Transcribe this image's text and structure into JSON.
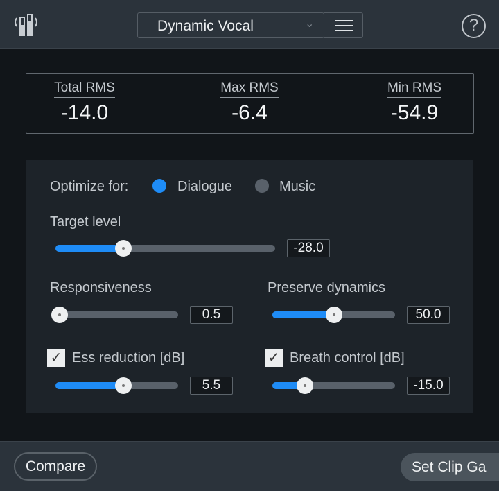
{
  "header": {
    "preset": "Dynamic Vocal",
    "logo_icon": "meter-bars-icon",
    "menu_icon": "hamburger-icon",
    "help_icon": "question-icon",
    "help_label": "?"
  },
  "metrics": [
    {
      "label": "Total RMS",
      "value": "-14.0"
    },
    {
      "label": "Max RMS",
      "value": "-6.4"
    },
    {
      "label": "Min RMS",
      "value": "-54.9"
    }
  ],
  "optimize": {
    "label": "Optimize for:",
    "options": [
      {
        "label": "Dialogue",
        "selected": true
      },
      {
        "label": "Music",
        "selected": false
      }
    ]
  },
  "controls": {
    "target": {
      "label": "Target level",
      "value": "-28.0",
      "level": 0.3
    },
    "responsiveness": {
      "label": "Responsiveness",
      "value": "0.5",
      "level": 0.0
    },
    "preserve": {
      "label": "Preserve dynamics",
      "value": "50.0",
      "level": 0.5
    },
    "ess": {
      "label": "Ess reduction [dB]",
      "value": "5.5",
      "level": 0.56,
      "checked": true
    },
    "breath": {
      "label": "Breath control [dB]",
      "value": "-15.0",
      "level": 0.25,
      "checked": true
    }
  },
  "checkmark": "✓",
  "footer": {
    "compare": "Compare",
    "set_clip": "Set Clip Ga"
  },
  "colors": {
    "accent": "#1e8cf7",
    "background": "#111519",
    "panel": "#1d2329"
  }
}
